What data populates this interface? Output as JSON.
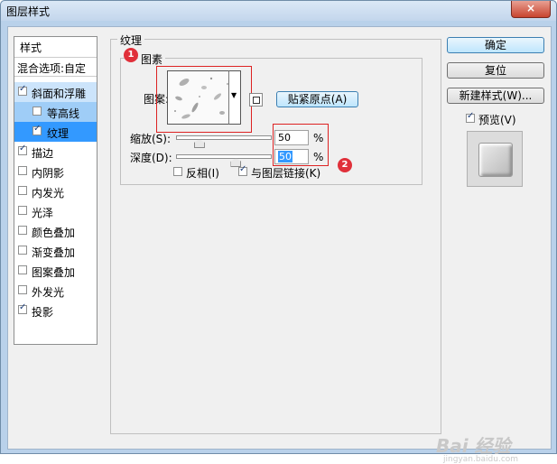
{
  "window": {
    "title": "图层样式",
    "close": "×"
  },
  "styles": {
    "header": "样式",
    "blending": "混合选项:自定",
    "items": [
      {
        "label": "斜面和浮雕",
        "checked": true
      },
      {
        "label": "等高线",
        "checked": false
      },
      {
        "label": "纹理",
        "checked": true
      },
      {
        "label": "描边",
        "checked": true
      },
      {
        "label": "内阴影",
        "checked": false
      },
      {
        "label": "内发光",
        "checked": false
      },
      {
        "label": "光泽",
        "checked": false
      },
      {
        "label": "颜色叠加",
        "checked": false
      },
      {
        "label": "渐变叠加",
        "checked": false
      },
      {
        "label": "图案叠加",
        "checked": false
      },
      {
        "label": "外发光",
        "checked": false
      },
      {
        "label": "投影",
        "checked": true
      }
    ]
  },
  "texture": {
    "group_title": "纹理",
    "elements_title": "图素",
    "pattern_label": "图案:",
    "snap_button": "贴紧原点(A)",
    "scale_label": "缩放(S):",
    "scale_value": "50",
    "depth_label": "深度(D):",
    "depth_value": "50",
    "percent": "%",
    "invert_label": "反相(I)",
    "invert_checked": false,
    "link_label": "与图层链接(K)",
    "link_checked": true,
    "scale_fraction": 0.23,
    "depth_fraction": 0.62
  },
  "buttons": {
    "ok": "确定",
    "reset": "复位",
    "new_style": "新建样式(W)...",
    "preview_label": "预览(V)",
    "preview_checked": true
  },
  "annotations": {
    "badge1": "1",
    "badge2": "2"
  },
  "watermark": {
    "text": "Bai 经验",
    "sub": "jingyan.baidu.com"
  },
  "colors": {
    "accent": "#3399ff",
    "annotation": "#dd2222"
  }
}
